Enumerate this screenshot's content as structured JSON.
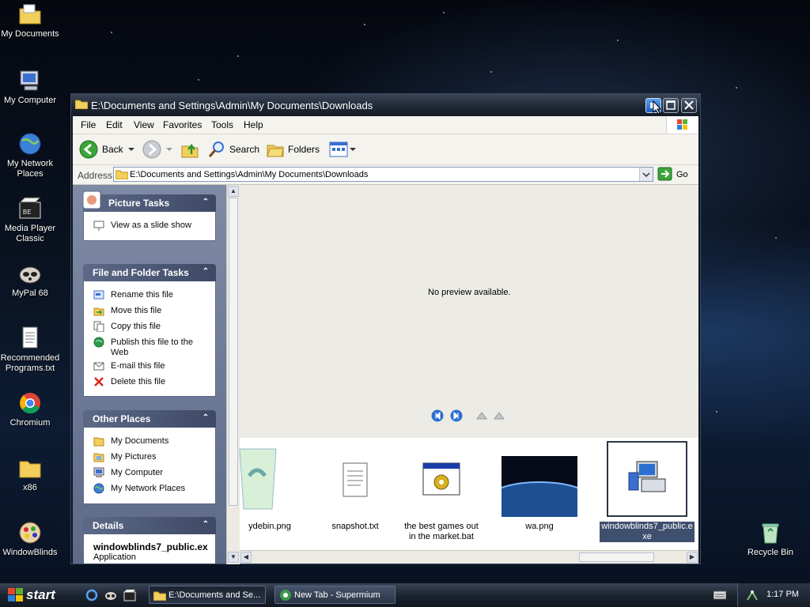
{
  "desktop": {
    "icons": [
      {
        "label": "My Documents",
        "icon": "folder-documents-icon"
      },
      {
        "label": "My Computer",
        "icon": "computer-icon"
      },
      {
        "label": "My Network Places",
        "icon": "network-globe-icon"
      },
      {
        "label": "Media Player Classic",
        "icon": "media-player-icon"
      },
      {
        "label": "MyPal 68",
        "icon": "mypal-raccoon-icon"
      },
      {
        "label": "Recommended Programs.txt",
        "icon": "text-file-icon"
      },
      {
        "label": "Chromium",
        "icon": "chromium-icon"
      },
      {
        "label": "x86",
        "icon": "folder-icon"
      },
      {
        "label": "WindowBlinds",
        "icon": "windowblinds-icon"
      },
      {
        "label": "Recycle Bin",
        "icon": "recycle-bin-icon"
      }
    ]
  },
  "window": {
    "title": "E:\\Documents and Settings\\Admin\\My Documents\\Downloads",
    "menu": [
      "File",
      "Edit",
      "View",
      "Favorites",
      "Tools",
      "Help"
    ],
    "toolbar": {
      "back": "Back",
      "search": "Search",
      "folders": "Folders"
    },
    "address": {
      "label": "Address",
      "value": "E:\\Documents and Settings\\Admin\\My Documents\\Downloads",
      "go": "Go"
    }
  },
  "tasks": {
    "picture": {
      "title": "Picture Tasks",
      "items": [
        "View as a slide show"
      ]
    },
    "file_folder": {
      "title": "File and Folder Tasks",
      "items": [
        "Rename this file",
        "Move this file",
        "Copy this file",
        "Publish this file to the Web",
        "E-mail this file",
        "Delete this file"
      ]
    },
    "other": {
      "title": "Other Places",
      "items": [
        "My Documents",
        "My Pictures",
        "My Computer",
        "My Network Places"
      ]
    },
    "details": {
      "title": "Details",
      "filename": "windowblinds7_public.ex",
      "type": "Application"
    }
  },
  "preview": {
    "message": "No preview available."
  },
  "filmstrip": [
    {
      "caption": "ydebin.png"
    },
    {
      "caption": "snapshot.txt"
    },
    {
      "caption": "the best games out in the market.bat"
    },
    {
      "caption": "wa.png"
    },
    {
      "caption": "windowblinds7_public.exe",
      "selected": true
    }
  ],
  "taskbar": {
    "start": "start",
    "tasks": [
      {
        "label": "E:\\Documents and Se...",
        "active": true
      },
      {
        "label": "New Tab - Supermium",
        "active": false
      }
    ],
    "clock": "1:17 PM"
  }
}
